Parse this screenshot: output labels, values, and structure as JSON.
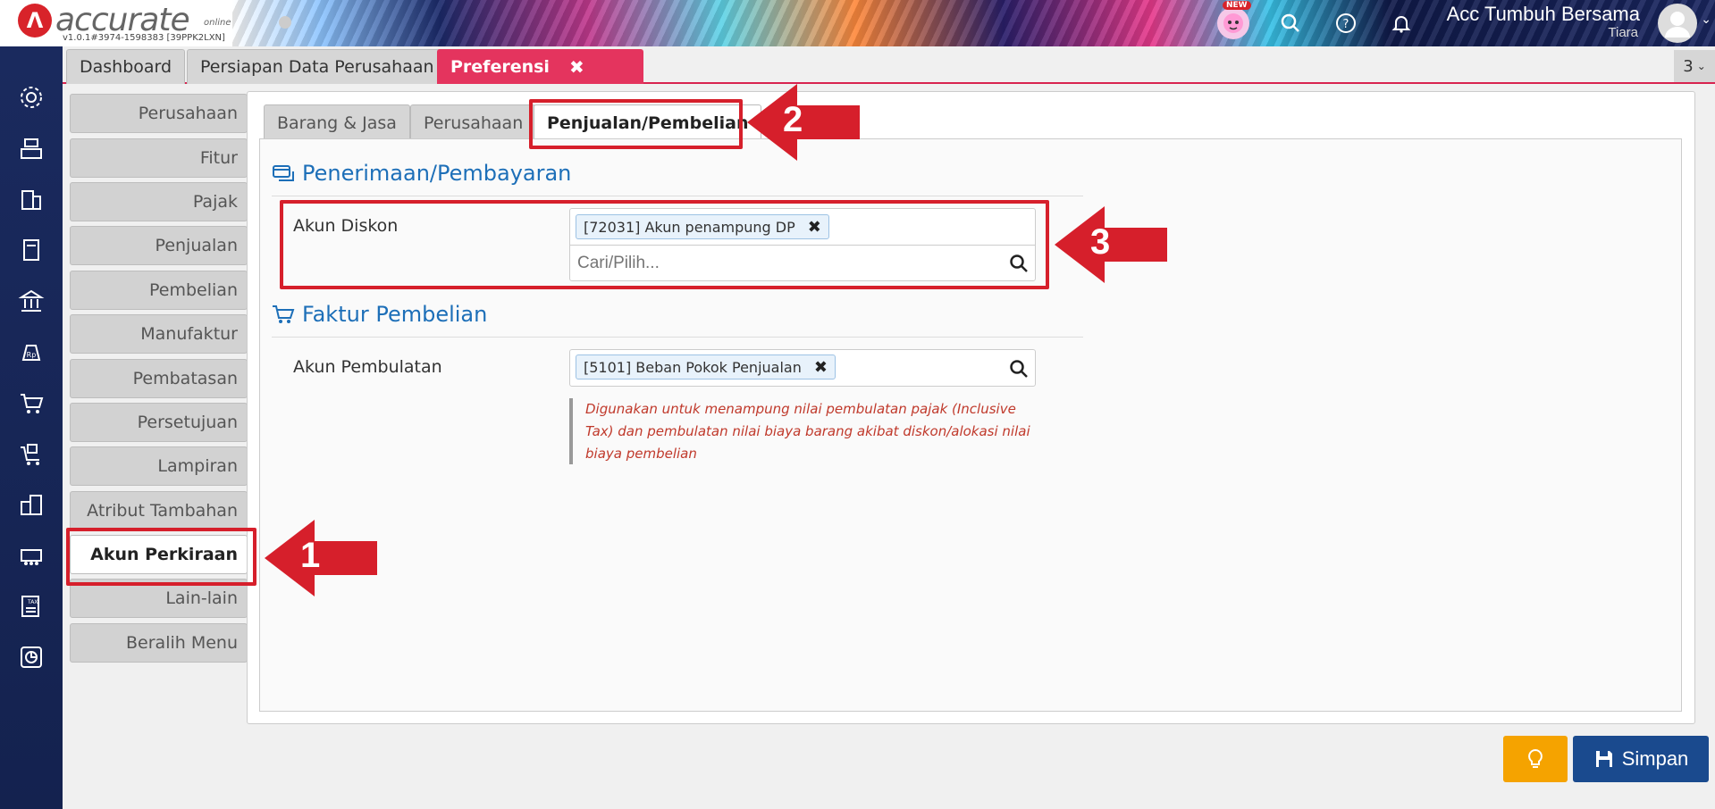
{
  "app": {
    "logo_text": "accurate",
    "logo_suffix": "online",
    "version": "v1.0.1#3974-1598383 [39PPK2LXN]",
    "new_badge": "NEW",
    "company_name": "Acc Tumbuh Bersama",
    "user_name": "Tiara"
  },
  "top_tabs": [
    {
      "label": "Dashboard"
    },
    {
      "label": "Persiapan Data Perusahaan"
    },
    {
      "label": "Preferensi"
    }
  ],
  "tab_count": "3",
  "side_menu": [
    {
      "label": "Perusahaan"
    },
    {
      "label": "Fitur"
    },
    {
      "label": "Pajak"
    },
    {
      "label": "Penjualan"
    },
    {
      "label": "Pembelian"
    },
    {
      "label": "Manufaktur"
    },
    {
      "label": "Pembatasan"
    },
    {
      "label": "Persetujuan"
    },
    {
      "label": "Lampiran"
    },
    {
      "label": "Atribut Tambahan"
    },
    {
      "label": "Akun Perkiraan"
    },
    {
      "label": "Lain-lain"
    },
    {
      "label": "Beralih Menu"
    }
  ],
  "sub_tabs": [
    {
      "label": "Barang & Jasa"
    },
    {
      "label": "Perusahaan"
    },
    {
      "label": "Penjualan/Pembelian"
    }
  ],
  "sections": {
    "receipt": {
      "title": "Penerimaan/Pembayaran",
      "field_label": "Akun Diskon",
      "chip": "[72031] Akun penampung DP",
      "search_placeholder": "Cari/Pilih..."
    },
    "purchase_invoice": {
      "title": "Faktur Pembelian",
      "field_label": "Akun Pembulatan",
      "chip": "[5101] Beban Pokok Penjualan",
      "hint_lines": [
        "Digunakan untuk menampung nilai pembulatan pajak (Inclusive",
        "Tax) dan pembulatan nilai biaya barang akibat diskon/alokasi nilai",
        "biaya pembelian"
      ]
    }
  },
  "buttons": {
    "save": "Simpan"
  },
  "annotations": {
    "step1": "1",
    "step2": "2",
    "step3": "3",
    "color": "#d61f2b"
  },
  "colors": {
    "accent_tab": "#e4345e",
    "rail": "#1a2a5e",
    "section_title": "#1d6fb8",
    "save_button": "#1a4a8e",
    "bulb_button": "#f5a300",
    "hint_text": "#c0392b"
  }
}
